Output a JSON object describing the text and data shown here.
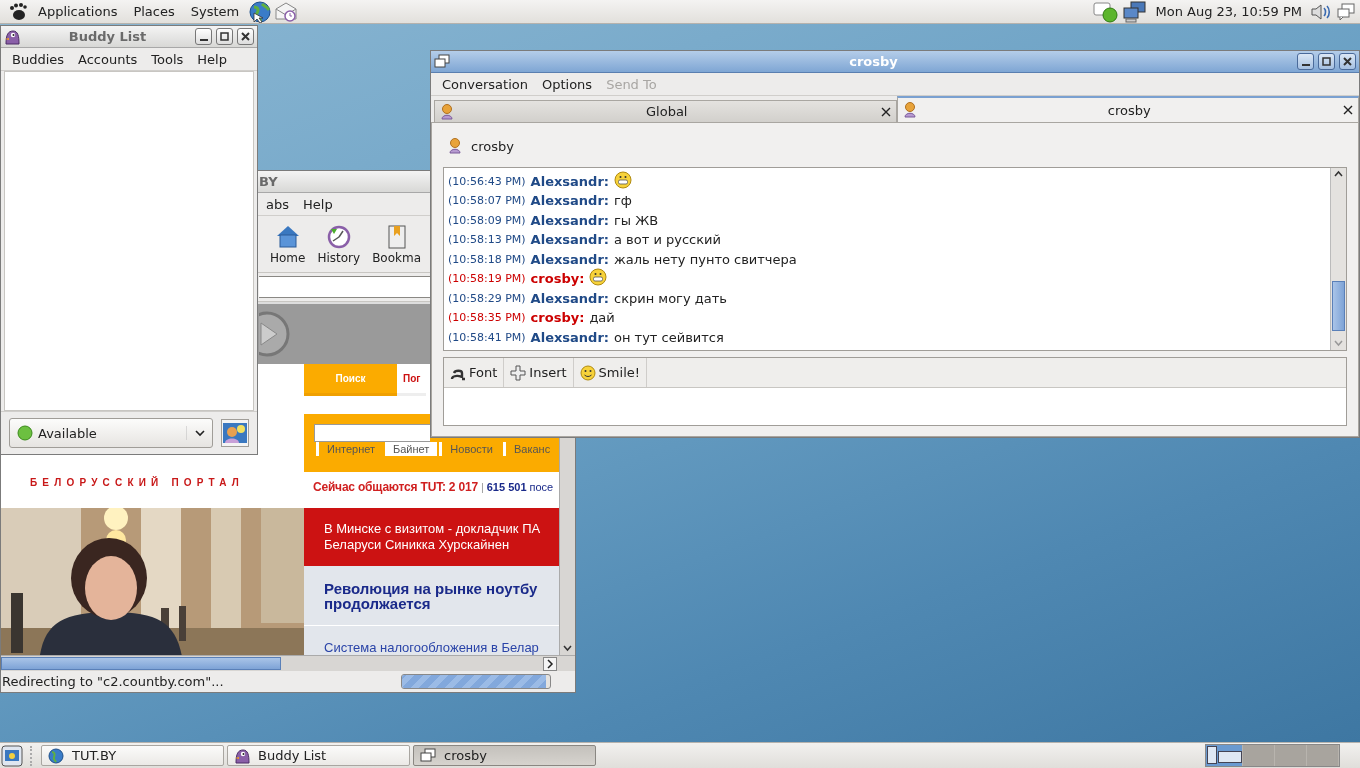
{
  "top_panel": {
    "menus": [
      "Applications",
      "Places",
      "System"
    ],
    "clock": "Mon Aug 23, 10:59 PM"
  },
  "buddy_list": {
    "title": "Buddy List",
    "active": false,
    "menu": [
      "Buddies",
      "Accounts",
      "Tools",
      "Help"
    ],
    "status": "Available"
  },
  "browser": {
    "title": "BY",
    "active": false,
    "menu": [
      "abs",
      "Help"
    ],
    "toolbar": [
      "Home",
      "History",
      "Bookma"
    ],
    "page": {
      "tabs": [
        {
          "label": "Поиск",
          "selected": true
        },
        {
          "label": "Пог",
          "selected": false
        }
      ],
      "logo_subtitle": "БЕЛОРУССКИЙ ПОРТАЛ",
      "search_tabs": [
        {
          "label": "Интернет",
          "selected": false
        },
        {
          "label": "Байнет",
          "selected": true
        },
        {
          "label": "Новости",
          "selected": false
        },
        {
          "label": "Ваканс",
          "selected": false
        }
      ],
      "online": {
        "label": "Сейчас общаются TUT: 2 017",
        "separator": "|",
        "count": "615 501",
        "suffix": "посе"
      },
      "news": [
        {
          "kind": "featured",
          "lines": [
            "В Минске с визитом - докладчик ПА",
            "Беларуси Синикка Хурскайнен"
          ]
        },
        {
          "kind": "headline",
          "lines": [
            "Революция на рынке ноутбу",
            "продолжается"
          ]
        },
        {
          "kind": "link",
          "lines": [
            "Система налогообложения в Белар"
          ]
        }
      ]
    },
    "status": "Redirecting to \"c2.countby.com\"...",
    "progress": {
      "level": 0.97
    }
  },
  "conversation": {
    "title": "crosby",
    "active": true,
    "menu": [
      {
        "label": "Conversation",
        "disabled": false
      },
      {
        "label": "Options",
        "disabled": false
      },
      {
        "label": "Send To",
        "disabled": true
      }
    ],
    "tabs": [
      {
        "label": "Global",
        "selected": false
      },
      {
        "label": "crosby",
        "selected": true
      }
    ],
    "buddy": "crosby",
    "messages": [
      {
        "kind": "received",
        "time": "(10:56:43 PM)",
        "sender": "Alexsandr:",
        "emoticon": true
      },
      {
        "kind": "received",
        "time": "(10:58:07 PM)",
        "sender": "Alexsandr:",
        "text": "гф",
        "emoticon": false
      },
      {
        "kind": "received",
        "time": "(10:58:09 PM)",
        "sender": "Alexsandr:",
        "text": "гы ЖВ",
        "emoticon": false
      },
      {
        "kind": "received",
        "time": "(10:58:13 PM)",
        "sender": "Alexsandr:",
        "text": "а вот и русский",
        "emoticon": false
      },
      {
        "kind": "received",
        "time": "(10:58:18 PM)",
        "sender": "Alexsandr:",
        "text": "жаль нету пунто свитчера",
        "emoticon": false
      },
      {
        "kind": "sent",
        "time": "(10:58:19 PM)",
        "sender": "crosby:",
        "emoticon": true
      },
      {
        "kind": "received",
        "time": "(10:58:29 PM)",
        "sender": "Alexsandr:",
        "text": "скрин могу дать",
        "emoticon": false
      },
      {
        "kind": "sent",
        "time": "(10:58:35 PM)",
        "sender": "crosby:",
        "text": "дай",
        "emoticon": false
      },
      {
        "kind": "received",
        "time": "(10:58:41 PM)",
        "sender": "Alexsandr:",
        "text": "он тут сейвится",
        "emoticon": false
      }
    ],
    "toolbar": [
      {
        "kind": "font",
        "label": "Font"
      },
      {
        "kind": "insert",
        "label": "Insert"
      },
      {
        "kind": "smile",
        "label": "Smile!"
      }
    ]
  },
  "taskbar": {
    "items": [
      {
        "kind": "browser",
        "label": "TUT.BY",
        "selected": false
      },
      {
        "kind": "buddies",
        "label": "Buddy List",
        "selected": false
      },
      {
        "kind": "chat",
        "label": "crosby",
        "selected": true
      }
    ],
    "workspaces": [
      {
        "selected": true
      },
      {
        "selected": false
      },
      {
        "selected": false
      },
      {
        "selected": false
      }
    ]
  }
}
